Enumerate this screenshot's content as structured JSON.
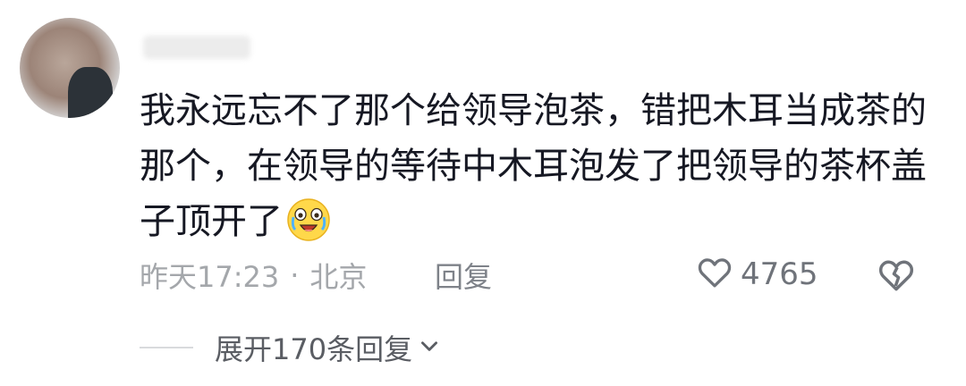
{
  "comment": {
    "text": "我永远忘不了那个给领导泡茶，错把木耳当成茶的那个，在领导的等待中木耳泡发了把领导的茶杯盖子顶开了",
    "emoji": "laughing-crying-emoji"
  },
  "meta": {
    "time": "昨天17:23",
    "separator": "·",
    "location": "北京",
    "reply_label": "回复"
  },
  "actions": {
    "like_count": "4765",
    "like_icon": "heart-outline-icon",
    "dislike_icon": "broken-heart-icon"
  },
  "replies": {
    "expand_label": "展开170条回复",
    "expand_icon": "chevron-down-icon"
  },
  "colors": {
    "text": "#161823",
    "meta": "#a4a7ab",
    "action": "#6f737a"
  }
}
